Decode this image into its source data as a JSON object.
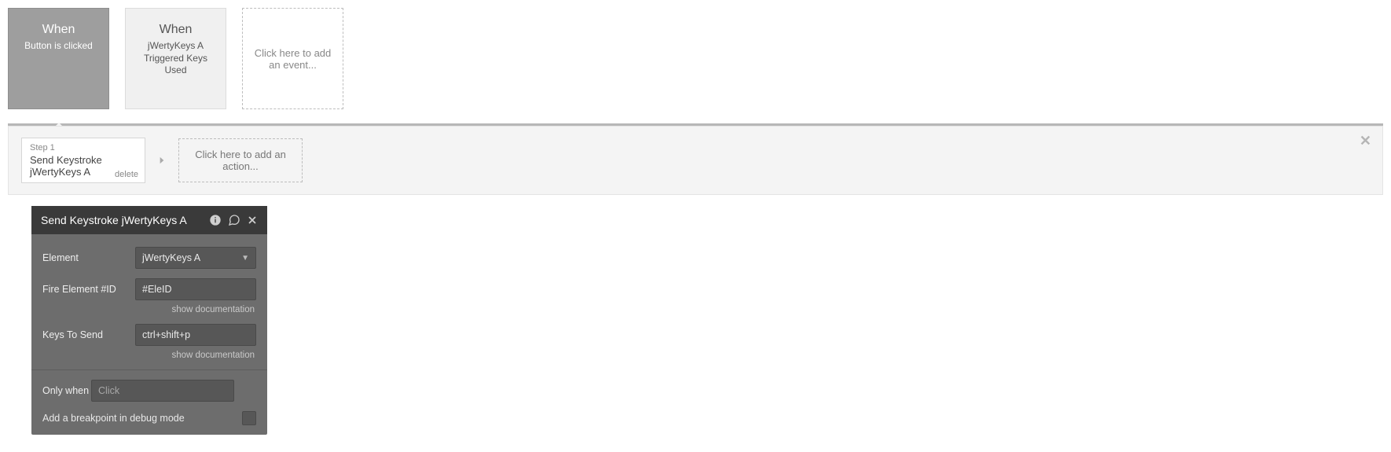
{
  "events": {
    "cards": [
      {
        "title": "When",
        "subtitle": "Button is clicked",
        "state": "active"
      },
      {
        "title": "When",
        "subtitle": "jWertyKeys A Triggered Keys Used",
        "state": "inactive"
      }
    ],
    "add_text": "Click here to add an event..."
  },
  "actions": {
    "step_label": "Step 1",
    "step_name": "Send Keystroke jWertyKeys A",
    "delete_label": "delete",
    "add_text": "Click here to add an action..."
  },
  "panel": {
    "title": "Send Keystroke jWertyKeys A",
    "element_label": "Element",
    "element_value": "jWertyKeys A",
    "fire_label": "Fire Element #ID",
    "fire_value": "#EleID",
    "keys_label": "Keys To Send",
    "keys_value": "ctrl+shift+p",
    "show_doc_label": "show documentation",
    "only_when_label": "Only when",
    "only_when_placeholder": "Click",
    "breakpoint_label": "Add a breakpoint in debug mode"
  }
}
